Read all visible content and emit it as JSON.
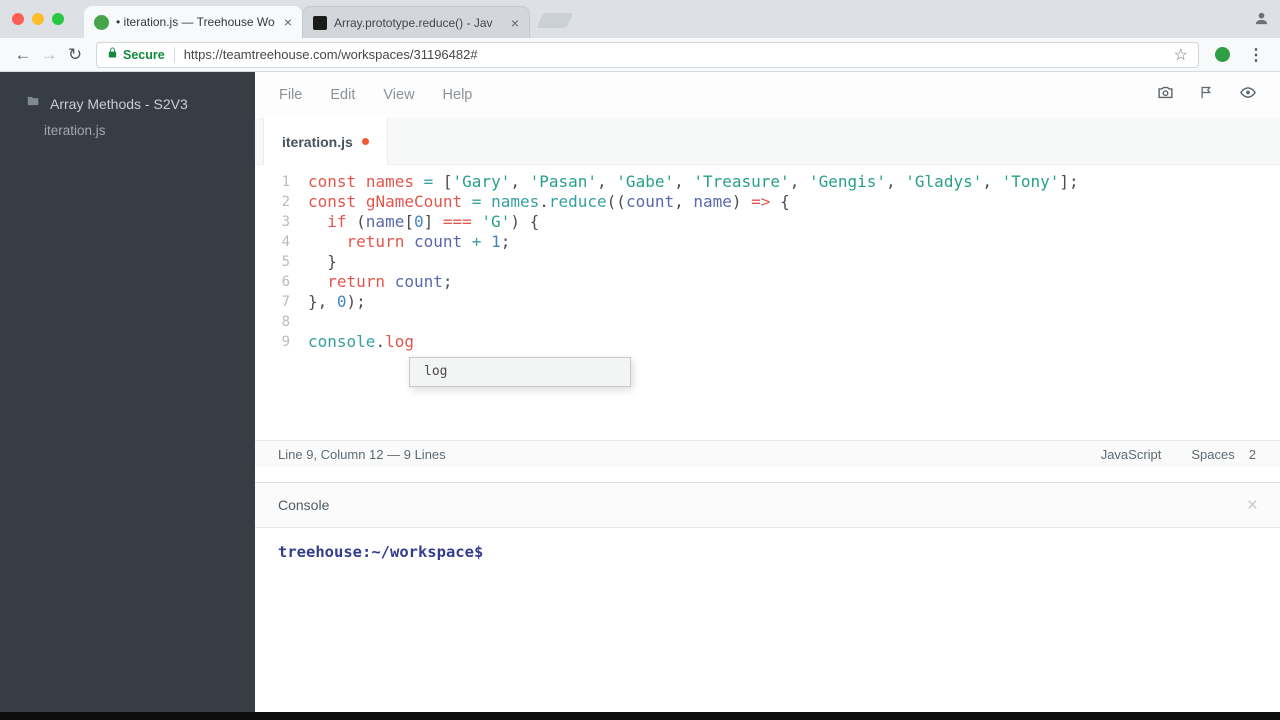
{
  "icons": {
    "back": "←",
    "forward": "→",
    "reload": "↻",
    "star": "☆",
    "kebab": "⋮",
    "close": "×"
  },
  "browser": {
    "tabs": [
      {
        "title": "• iteration.js — Treehouse Wo",
        "active": true
      },
      {
        "title": "Array.prototype.reduce() - Jav",
        "active": false
      }
    ],
    "security_label": "Secure",
    "url": "https://teamtreehouse.com/workspaces/31196482#"
  },
  "workspace": {
    "sidebar": {
      "project": "Array Methods - S2V3",
      "file": "iteration.js"
    },
    "menu": {
      "items": [
        "File",
        "Edit",
        "View",
        "Help"
      ]
    },
    "filetab": {
      "name": "iteration.js"
    },
    "editor": {
      "palette": {
        "k": "#e2574d",
        "o": "#36a0a0",
        "f": "#36a0a0",
        "s": "#27a08b",
        "v": "#5968a8",
        "n": "#4183c4",
        "p": "#4d4d4d"
      },
      "lines": [
        {
          "num": "1",
          "tokens": [
            [
              "k",
              "const"
            ],
            [
              "p",
              " "
            ],
            [
              "k",
              "names"
            ],
            [
              "p",
              " "
            ],
            [
              "o",
              "="
            ],
            [
              "p",
              " ["
            ],
            [
              "s",
              "'Gary'"
            ],
            [
              "p",
              ", "
            ],
            [
              "s",
              "'Pasan'"
            ],
            [
              "p",
              ", "
            ],
            [
              "s",
              "'Gabe'"
            ],
            [
              "p",
              ", "
            ],
            [
              "s",
              "'Treasure'"
            ],
            [
              "p",
              ", "
            ],
            [
              "s",
              "'Gengis'"
            ],
            [
              "p",
              ", "
            ],
            [
              "s",
              "'Gladys'"
            ],
            [
              "p",
              ", "
            ],
            [
              "s",
              "'Tony'"
            ],
            [
              "p",
              "];"
            ]
          ]
        },
        {
          "num": "2",
          "tokens": [
            [
              "k",
              "const"
            ],
            [
              "p",
              " "
            ],
            [
              "k",
              "gNameCount"
            ],
            [
              "p",
              " "
            ],
            [
              "o",
              "="
            ],
            [
              "p",
              " "
            ],
            [
              "f",
              "names"
            ],
            [
              "p",
              "."
            ],
            [
              "f",
              "reduce"
            ],
            [
              "p",
              "(("
            ],
            [
              "v",
              "count"
            ],
            [
              "p",
              ", "
            ],
            [
              "v",
              "name"
            ],
            [
              "p",
              ") "
            ],
            [
              "k",
              "=>"
            ],
            [
              "p",
              " {"
            ]
          ]
        },
        {
          "num": "3",
          "tokens": [
            [
              "p",
              "  "
            ],
            [
              "k",
              "if"
            ],
            [
              "p",
              " ("
            ],
            [
              "v",
              "name"
            ],
            [
              "p",
              "["
            ],
            [
              "n",
              "0"
            ],
            [
              "p",
              "] "
            ],
            [
              "k",
              "==="
            ],
            [
              "p",
              " "
            ],
            [
              "s",
              "'G'"
            ],
            [
              "p",
              ") {"
            ]
          ]
        },
        {
          "num": "4",
          "tokens": [
            [
              "p",
              "    "
            ],
            [
              "k",
              "return"
            ],
            [
              "p",
              " "
            ],
            [
              "v",
              "count"
            ],
            [
              "p",
              " "
            ],
            [
              "o",
              "+"
            ],
            [
              "p",
              " "
            ],
            [
              "n",
              "1"
            ],
            [
              "p",
              ";"
            ]
          ]
        },
        {
          "num": "5",
          "tokens": [
            [
              "p",
              "  }"
            ]
          ]
        },
        {
          "num": "6",
          "tokens": [
            [
              "p",
              "  "
            ],
            [
              "k",
              "return"
            ],
            [
              "p",
              " "
            ],
            [
              "v",
              "count"
            ],
            [
              "p",
              ";"
            ]
          ]
        },
        {
          "num": "7",
          "tokens": [
            [
              "p",
              "}, "
            ],
            [
              "n",
              "0"
            ],
            [
              "p",
              ");"
            ]
          ]
        },
        {
          "num": "8",
          "tokens": []
        },
        {
          "num": "9",
          "tokens": [
            [
              "f",
              "console"
            ],
            [
              "p",
              "."
            ],
            [
              "k",
              "log"
            ]
          ]
        }
      ],
      "autocomplete": {
        "items": [
          "log"
        ]
      },
      "status": {
        "position": "Line 9, Column 12 — 9 Lines",
        "language": "JavaScript",
        "indent_type": "Spaces",
        "indent_size": "2"
      }
    },
    "console": {
      "title": "Console",
      "prompt": "treehouse:~/workspace$"
    }
  }
}
